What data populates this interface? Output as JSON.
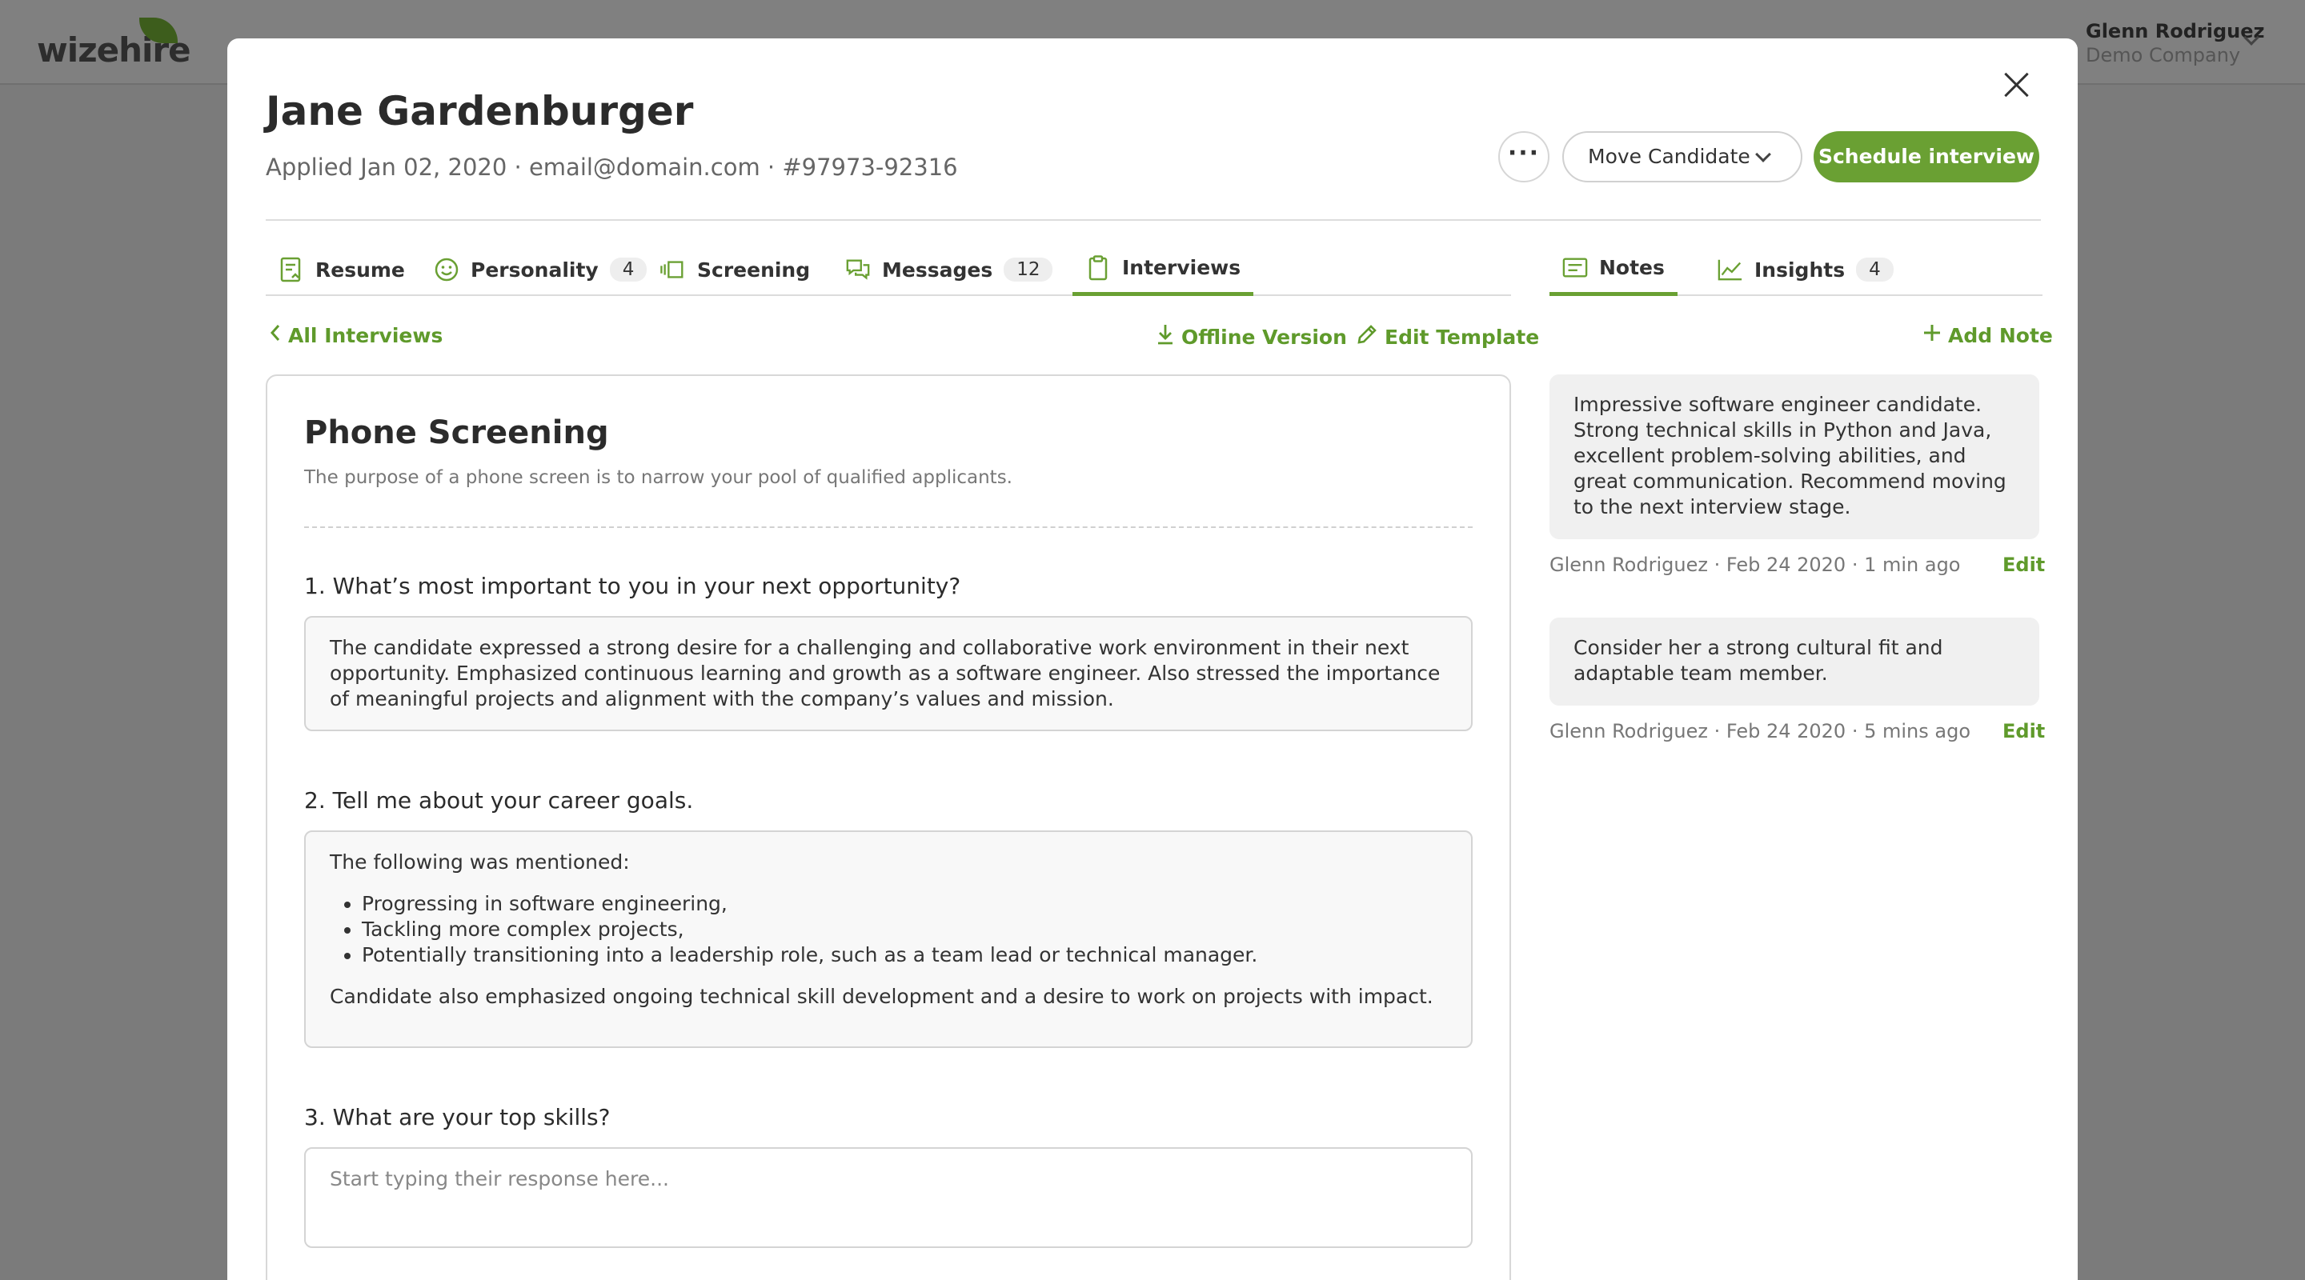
{
  "app": {
    "logo": "wizehire",
    "user_name": "Glenn Rodriguez",
    "company": "Demo Company"
  },
  "candidate": {
    "name": "Jane Gardenburger",
    "meta": "Applied Jan 02, 2020 · email@domain.com · #97973-92316"
  },
  "actions": {
    "more_label": "···",
    "move_label": "Move Candidate",
    "schedule_label": "Schedule interview"
  },
  "tabs": [
    {
      "label": "Resume",
      "icon": "resume-icon"
    },
    {
      "label": "Personality",
      "count": "4",
      "icon": "smile-icon"
    },
    {
      "label": "Screening",
      "icon": "screening-icon"
    },
    {
      "label": "Messages",
      "count": "12",
      "icon": "messages-icon"
    },
    {
      "label": "Interviews",
      "icon": "clipboard-icon",
      "active": true
    }
  ],
  "right_tabs": [
    {
      "label": "Notes",
      "icon": "notes-icon",
      "active": true
    },
    {
      "label": "Insights",
      "count": "4",
      "icon": "chart-icon"
    }
  ],
  "toolbar": {
    "back_label": "All Interviews",
    "offline_label": "Offline Version",
    "edit_template_label": "Edit Template",
    "add_note_label": "Add Note"
  },
  "interview": {
    "title": "Phone Screening",
    "subtitle": "The purpose of a phone screen is to narrow your pool of qualified applicants.",
    "questions": [
      {
        "q": "1. What’s most important to you in your next opportunity?",
        "answer": "The candidate expressed a strong desire for a challenging and collaborative work environment in their next opportunity. Emphasized continuous learning and growth as a software engineer. Also stressed the importance of meaningful projects and alignment with the company’s values and mission."
      },
      {
        "q": "2. Tell me about your career goals.",
        "intro": "The following was mentioned:",
        "bullets": [
          "Progressing in software engineering,",
          "Tackling more complex projects,",
          "Potentially transitioning into a leadership role, such as a team lead or technical manager."
        ],
        "outro": "Candidate also emphasized ongoing technical skill development and a desire to work on projects with impact."
      },
      {
        "q": "3. What are your top skills?",
        "placeholder": "Start typing their response here..."
      }
    ]
  },
  "notes": [
    {
      "text": "Impressive software engineer candidate. Strong technical skills in Python and Java, excellent problem-solving abilities, and great communication. Recommend moving to the next interview stage.",
      "meta": "Glenn Rodriguez · Feb 24 2020 · 1 min ago",
      "edit": "Edit"
    },
    {
      "text": "Consider her a strong cultural fit and adaptable team member.",
      "meta": "Glenn Rodriguez · Feb 24 2020 · 5 mins ago",
      "edit": "Edit"
    }
  ],
  "colors": {
    "accent": "#6aa033",
    "overlay": "#7b7b7b"
  }
}
